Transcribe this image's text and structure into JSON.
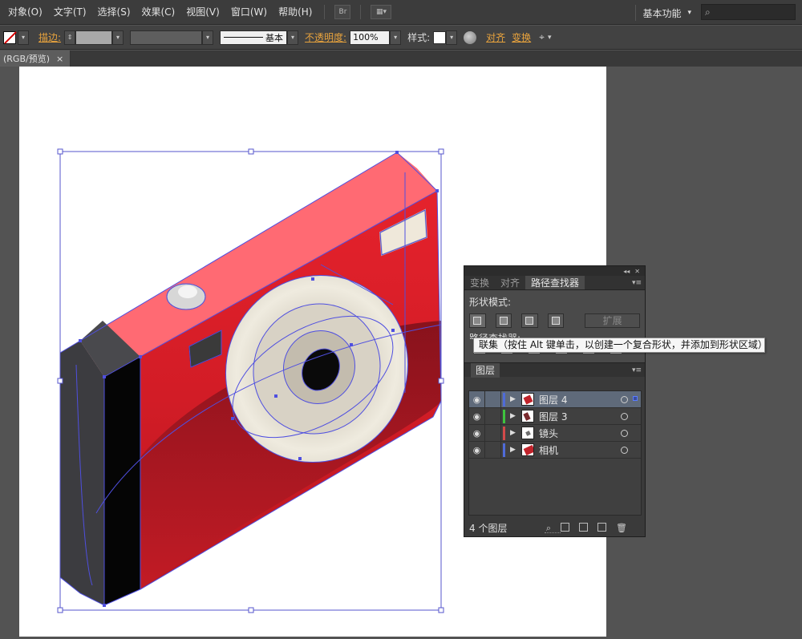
{
  "menubar": {
    "items": [
      "对象(O)",
      "文字(T)",
      "选择(S)",
      "效果(C)",
      "视图(V)",
      "窗口(W)",
      "帮助(H)"
    ],
    "bridge_label": "Br",
    "workspace": "基本功能",
    "workspace_arrow": "▾",
    "search_icon": "search-icon"
  },
  "control_bar": {
    "stroke_label": "描边:",
    "stroke_style": "基本",
    "opacity_label": "不透明度:",
    "opacity_value": "100%",
    "style_label": "样式:",
    "align_label": "对齐",
    "transform_label": "变换"
  },
  "document": {
    "tab_label": "(RGB/预览)",
    "tab_close": "×"
  },
  "pathfinder_panel": {
    "tabs": [
      "变换",
      "对齐",
      "路径查找器"
    ],
    "active_tab": 2,
    "shape_modes_label": "形状模式:",
    "expand_label": "扩展",
    "pathfinders_label": "路径查找器:"
  },
  "tooltip": {
    "text": "联集（按住 Alt 键单击，以创建一个复合形状，并添加到形状区域）"
  },
  "layers_panel": {
    "title": "图层",
    "layers": [
      {
        "name": "图层 4",
        "color": "#4f6bd8",
        "selected": true
      },
      {
        "name": "图层 3",
        "color": "#3ec43e",
        "selected": false
      },
      {
        "name": "镜头",
        "color": "#d24a4a",
        "selected": false
      },
      {
        "name": "相机",
        "color": "#4f6bd8",
        "selected": false
      }
    ],
    "count_label": "4 个图层"
  },
  "colors": {
    "accent_orange": "#e8a33d",
    "camera_red": "#dc1c26",
    "camera_top": "#ff6a73",
    "selection": "#4444dd"
  }
}
